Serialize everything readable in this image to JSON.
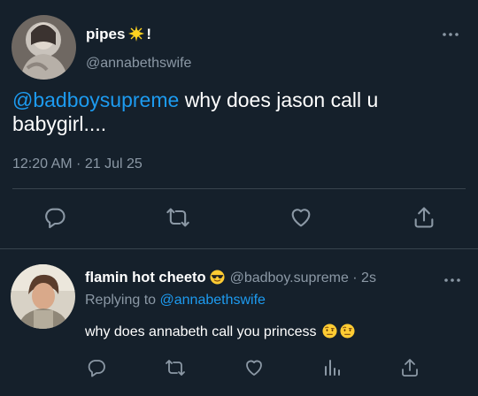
{
  "main_tweet": {
    "display_name": "pipes",
    "name_suffix": "!",
    "handle": "@annabethswife",
    "mention": "@badboysupreme",
    "text_line1": "why does jason call u",
    "text_line2": "babygirl....",
    "timestamp": "12:20 AM · 21 Jul 25",
    "icons": [
      "reply-icon",
      "retweet-icon",
      "like-icon",
      "share-icon"
    ]
  },
  "reply": {
    "display_name": "flamin hot cheeto",
    "handle_time": "@badboy.supreme · 2s",
    "replying_prefix": "Replying to",
    "replying_handle": "@annabethswife",
    "text": "why does annabeth call you princess",
    "icons": [
      "reply-icon",
      "retweet-icon",
      "like-icon",
      "views-icon",
      "share-icon"
    ]
  },
  "colors": {
    "background": "#15202b",
    "accent": "#1d9bf0",
    "secondary_text": "#8b98a5",
    "divider": "#38444d"
  }
}
